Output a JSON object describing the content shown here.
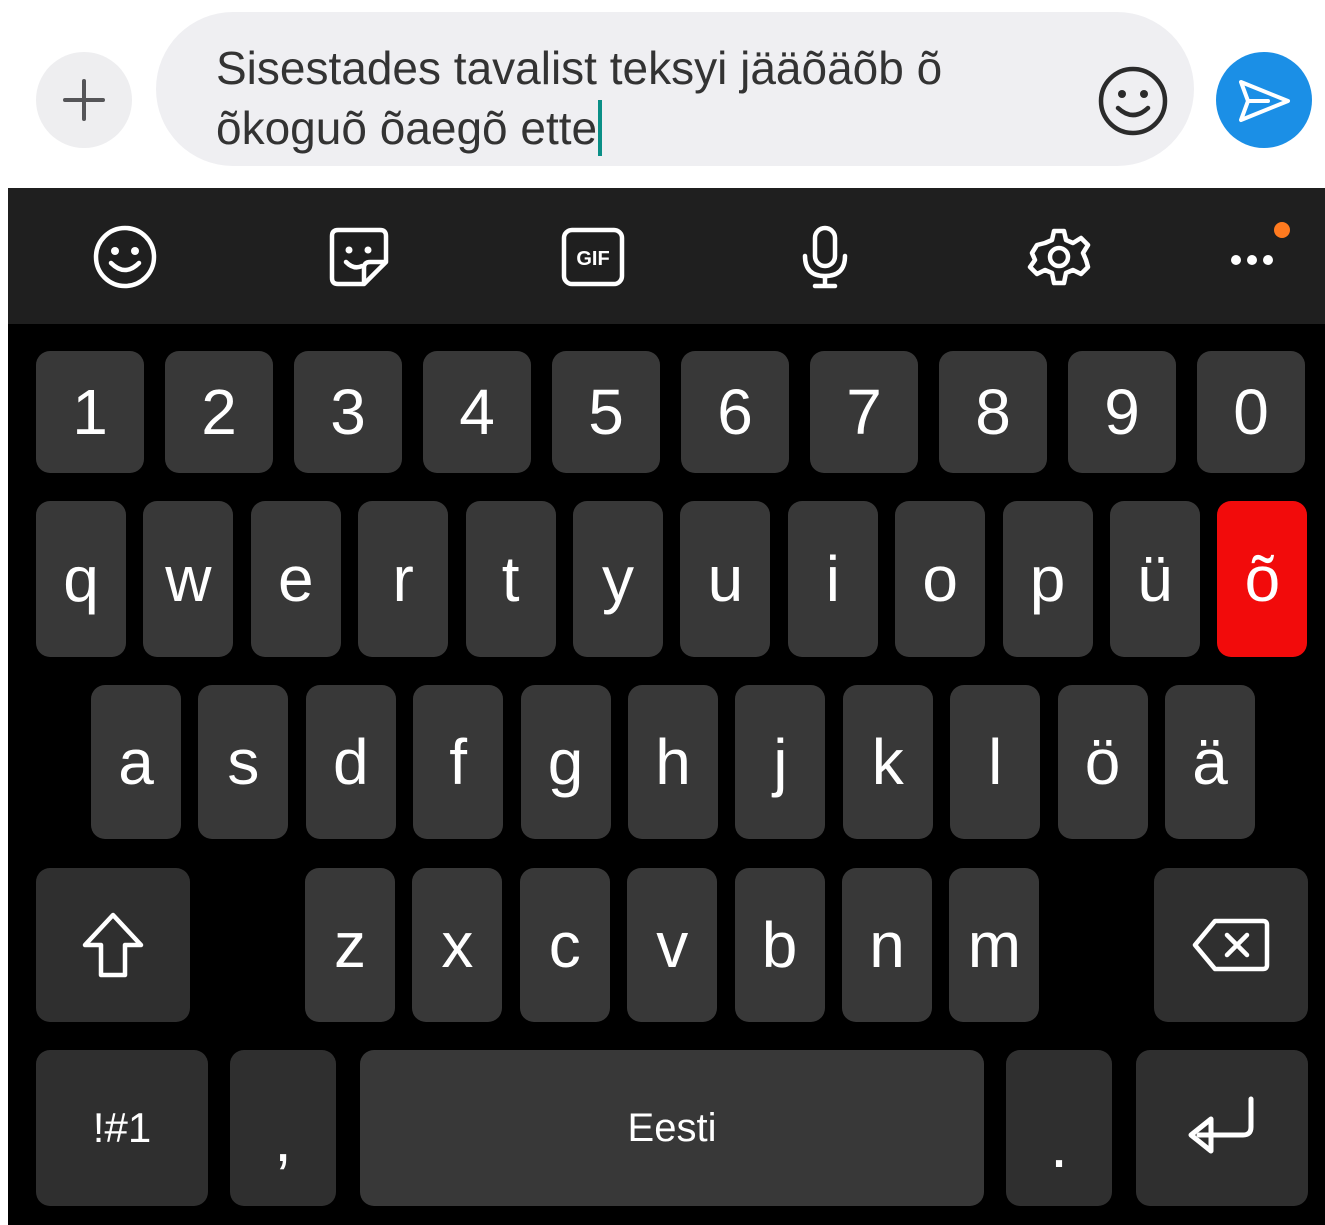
{
  "composer": {
    "text": "Sisestades tavalist teksyi jääõäõb õ õkoguõ õaegõ ette",
    "plus_icon": "plus-icon",
    "emoji_icon": "smiley-icon",
    "send_icon": "send-icon",
    "send_color": "#1b8fe6"
  },
  "toolbar": {
    "items": [
      {
        "icon": "smiley-icon"
      },
      {
        "icon": "sticker-icon"
      },
      {
        "icon": "gif-icon",
        "label": "GIF"
      },
      {
        "icon": "microphone-icon"
      },
      {
        "icon": "gear-icon"
      },
      {
        "icon": "more-dots-icon",
        "badge_color": "#ff7a1f"
      }
    ]
  },
  "keyboard": {
    "number_row": [
      "1",
      "2",
      "3",
      "4",
      "5",
      "6",
      "7",
      "8",
      "9",
      "0"
    ],
    "row1": [
      "q",
      "w",
      "e",
      "r",
      "t",
      "y",
      "u",
      "i",
      "o",
      "p",
      "ü",
      "õ"
    ],
    "row2": [
      "a",
      "s",
      "d",
      "f",
      "g",
      "h",
      "j",
      "k",
      "l",
      "ö",
      "ä"
    ],
    "row3": [
      "z",
      "x",
      "c",
      "v",
      "b",
      "n",
      "m"
    ],
    "symbols_label": "!#1",
    "comma_label": ",",
    "space_label": "Eesti",
    "period_label": ".",
    "highlighted_key": "õ",
    "highlight_color": "#f20b0b",
    "shift_icon": "shift-arrow-icon",
    "backspace_icon": "backspace-icon",
    "enter_icon": "enter-icon"
  }
}
